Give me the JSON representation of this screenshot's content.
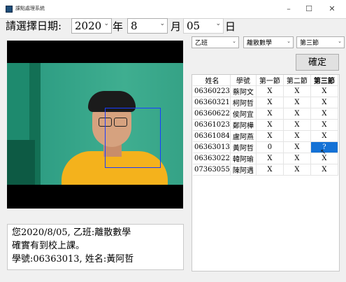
{
  "window": {
    "title": "課點處理系統",
    "minimize": "–",
    "maximize": "☐",
    "close": "✕"
  },
  "date_picker": {
    "label": "請選擇日期:",
    "year": "2020",
    "year_unit": "年",
    "month": "8",
    "month_unit": "月",
    "day": "05",
    "day_unit": "日"
  },
  "filters": {
    "class": "乙班",
    "course": "離散數學",
    "period": "第三節"
  },
  "confirm_label": "確定",
  "message": {
    "line1": "您2020/8/05, 乙班:離散數學",
    "line2": "確實有到校上課。",
    "line3": "學號:06363013, 姓名:黃阿哲"
  },
  "roster": {
    "headers": [
      "姓名",
      "學號",
      "第一節",
      "第二節",
      "第三節"
    ],
    "rows": [
      [
        "06360223",
        "蔡阿文",
        "X",
        "X",
        "X"
      ],
      [
        "06360321",
        "柯阿哲",
        "X",
        "X",
        "X"
      ],
      [
        "06360622",
        "侯阿宜",
        "X",
        "X",
        "X"
      ],
      [
        "06361023",
        "鄭阿樺",
        "X",
        "X",
        "X"
      ],
      [
        "06361084",
        "盧阿燕",
        "X",
        "X",
        "X"
      ],
      [
        "06363013",
        "黃阿哲",
        "0",
        "X",
        "?"
      ],
      [
        "06363022",
        "韓阿瑜",
        "X",
        "X",
        "X"
      ],
      [
        "07363055",
        "陳阿遇",
        "X",
        "X",
        "X"
      ]
    ]
  },
  "colors": {
    "selected_cell": "#1472d6",
    "face_box": "#1a3cff",
    "shirt": "#f4b21c",
    "wall": "#2e9d83"
  }
}
